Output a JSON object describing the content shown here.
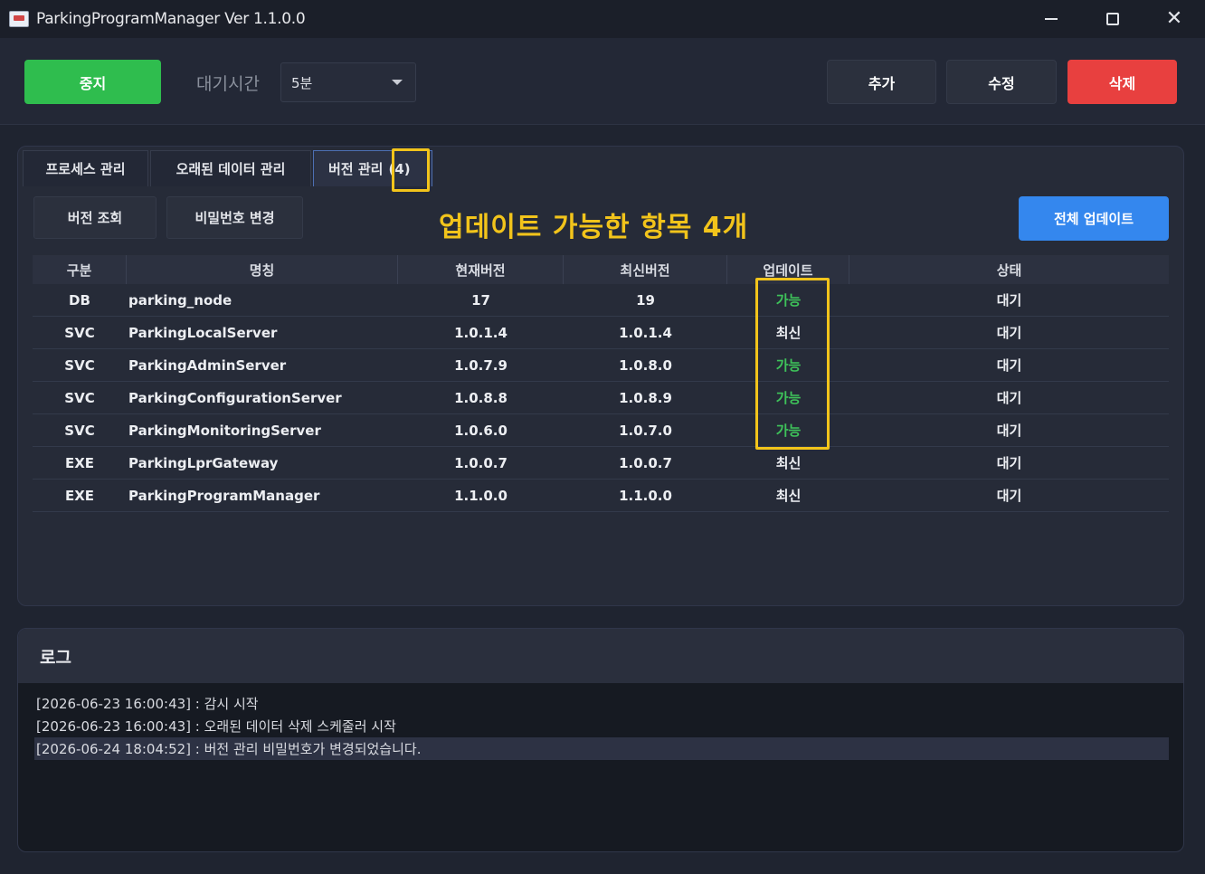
{
  "window": {
    "title": "ParkingProgramManager Ver 1.1.0.0",
    "icon": "app-icon",
    "controls": [
      "minimize-icon",
      "maximize-icon",
      "close-icon"
    ]
  },
  "toolbar": {
    "stop_label": "중지",
    "wait_label": "대기시간",
    "wait_value": "5분",
    "add_label": "추가",
    "edit_label": "수정",
    "delete_label": "삭제"
  },
  "tabs": [
    {
      "label": "프로세스 관리"
    },
    {
      "label": "오래된 데이터 관리"
    },
    {
      "label": "버전 관리",
      "count": "(4)"
    }
  ],
  "version_tab": {
    "query_label": "버전 조회",
    "password_label": "비밀번호 변경",
    "update_all_label": "전체 업데이트",
    "annotation": "업데이트 가능한 항목 4개"
  },
  "table": {
    "headers": [
      "구분",
      "명칭",
      "현재버전",
      "최신버전",
      "업데이트",
      "상태"
    ],
    "rows": [
      [
        "DB",
        "parking_node",
        "17",
        "19",
        "가능",
        "대기"
      ],
      [
        "SVC",
        "ParkingLocalServer",
        "1.0.1.4",
        "1.0.1.4",
        "최신",
        "대기"
      ],
      [
        "SVC",
        "ParkingAdminServer",
        "1.0.7.9",
        "1.0.8.0",
        "가능",
        "대기"
      ],
      [
        "SVC",
        "ParkingConfigurationServer",
        "1.0.8.8",
        "1.0.8.9",
        "가능",
        "대기"
      ],
      [
        "SVC",
        "ParkingMonitoringServer",
        "1.0.6.0",
        "1.0.7.0",
        "가능",
        "대기"
      ],
      [
        "EXE",
        "ParkingLprGateway",
        "1.0.0.7",
        "1.0.0.7",
        "최신",
        "대기"
      ],
      [
        "EXE",
        "ParkingProgramManager",
        "1.1.0.0",
        "1.1.0.0",
        "최신",
        "대기"
      ]
    ]
  },
  "log": {
    "title": "로그",
    "lines": [
      "[2026-06-23 16:00:43] : 감시 시작",
      "[2026-06-23 16:00:43] : 오래된 데이터 삭제 스케줄러 시작",
      "[2026-06-24 18:04:52] : 버전 관리 비밀번호가 변경되었습니다."
    ]
  },
  "colors": {
    "stop": "#2fbd4e",
    "delete": "#e8403f",
    "update_all": "#3487ee",
    "annotation": "#f2c41b",
    "available": "#3ec35a"
  }
}
